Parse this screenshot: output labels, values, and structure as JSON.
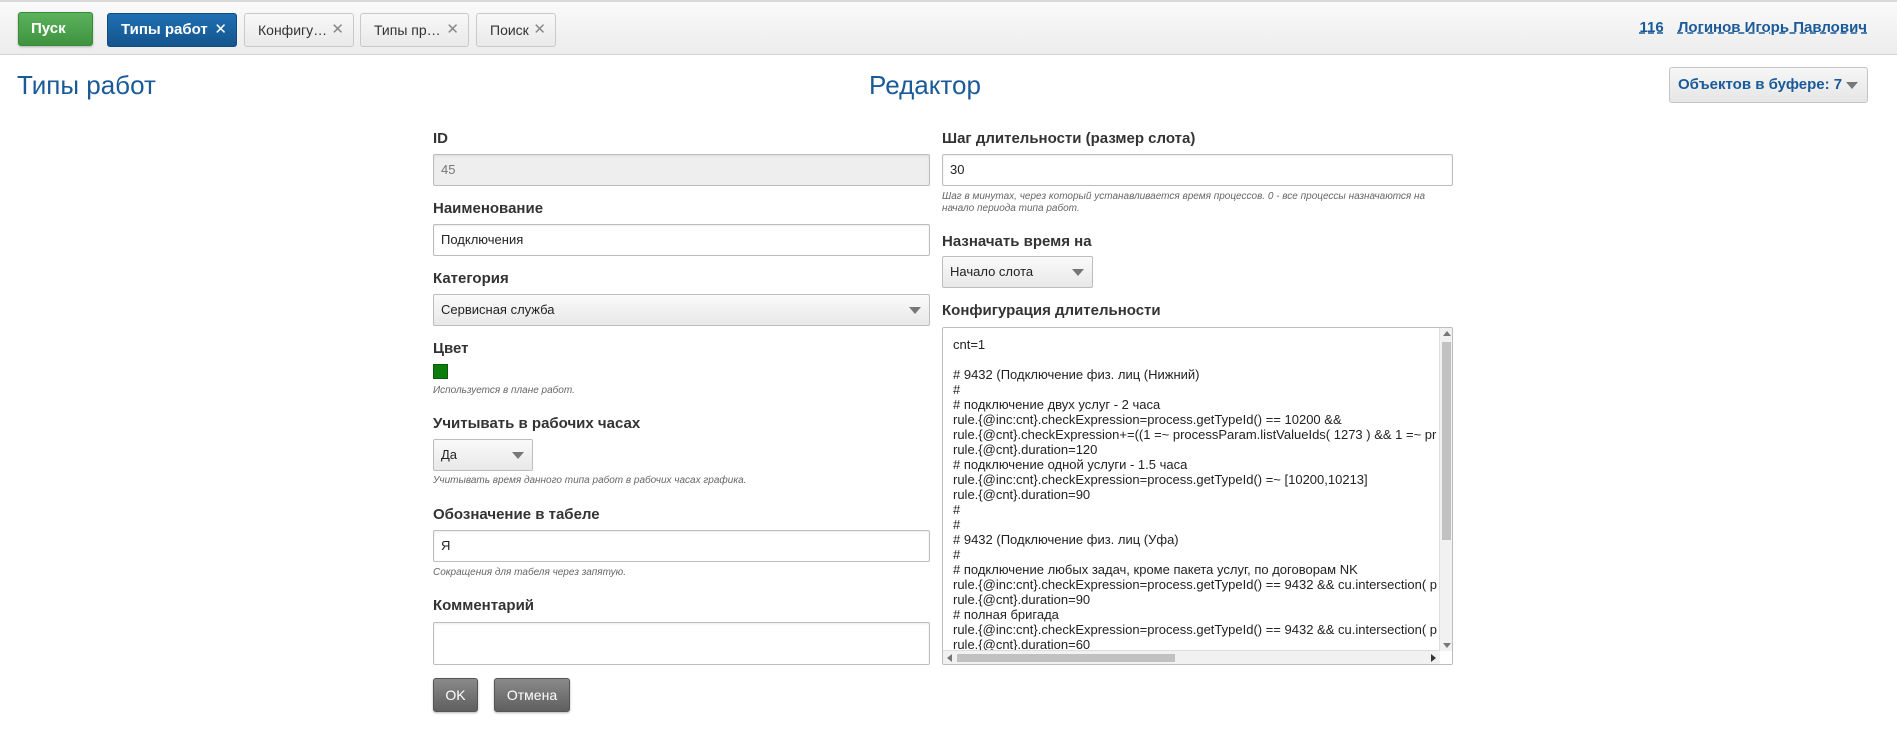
{
  "topbar": {
    "start_label": "Пуск",
    "tabs": [
      {
        "label": "Типы работ",
        "active": true
      },
      {
        "label": "Конфигу…",
        "active": false
      },
      {
        "label": "Типы пр…",
        "active": false
      },
      {
        "label": "Поиск",
        "active": false
      }
    ],
    "close_glyph": "✕",
    "user_number": "116",
    "user_name": "Логинов Игорь Павлович"
  },
  "page_title": "Типы работ",
  "editor_title": "Редактор",
  "buffer_label": "Объектов в буфере: 7",
  "form_left": {
    "id_label": "ID",
    "id_value": "45",
    "name_label": "Наименование",
    "name_value": "Подключения",
    "category_label": "Категория",
    "category_value": "Сервисная служба",
    "color_label": "Цвет",
    "color_value": "#0a7d0a",
    "color_hint": "Используется в плане работ.",
    "work_hours_label": "Учитывать в рабочих часах",
    "work_hours_value": "Да",
    "work_hours_hint": "Учитывать время данного типа работ в рабочих часах графика.",
    "table_label": "Обозначение в табеле",
    "table_value": "Я",
    "table_hint": "Сокращения для табеля через запятую.",
    "comment_label": "Комментарий",
    "comment_value": ""
  },
  "form_right": {
    "step_label": "Шаг длительности (размер слота)",
    "step_value": "30",
    "step_hint_1": "Шаг в минутах, через который устанавливается время процессов. 0 - все процессы назначаются на",
    "step_hint_2": "начало периода типа работ.",
    "assign_label": "Назначать время на",
    "assign_value": "Начало слота",
    "config_label": "Конфигурация длительности",
    "config_lines": [
      "cnt=1",
      "",
      "# 9432 (Подключение физ. лиц (Нижний)",
      "#",
      "# подключение двух услуг - 2 часа",
      "rule.{@inc:cnt}.checkExpression=process.getTypeId() == 10200 &&",
      "rule.{@cnt}.checkExpression+=((1 =~ processParam.listValueIds( 1273 ) && 1 =~ pr",
      "rule.{@cnt}.duration=120",
      "# подключение одной услуги - 1.5 часа",
      "rule.{@inc:cnt}.checkExpression=process.getTypeId() =~ [10200,10213]",
      "rule.{@cnt}.duration=90",
      "#",
      "#",
      "# 9432 (Подключение физ. лиц (Уфа)",
      "#",
      "# подключение любых задач, кроме пакета услуг, по договорам NK",
      "rule.{@inc:cnt}.checkExpression=process.getTypeId() == 9432 && cu.intersection( p",
      "rule.{@cnt}.duration=90",
      "# полная бригада",
      "rule.{@inc:cnt}.checkExpression=process.getTypeId() == 9432 && cu.intersection( p",
      "rule.{@cnt}.duration=60"
    ]
  },
  "buttons": {
    "ok_label": "OK",
    "cancel_label": "Отмена"
  }
}
